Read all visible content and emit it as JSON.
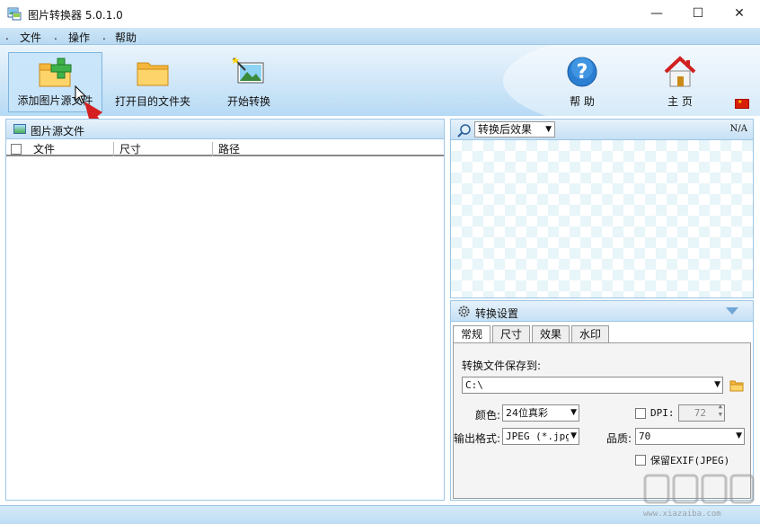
{
  "window": {
    "title": "图片转换器 5.0.1.0",
    "controls": {
      "minimize": "—",
      "maximize": "☐",
      "close": "✕"
    }
  },
  "menu": {
    "items": [
      "文件",
      "操作",
      "帮助"
    ]
  },
  "toolbar": {
    "add_source": "添加图片源文件",
    "open_target_folder": "打开目的文件夹",
    "start_convert": "开始转换",
    "help": "帮 助",
    "home": "主 页"
  },
  "left_panel": {
    "title": "图片源文件",
    "columns": [
      "文件",
      "尺寸",
      "路径"
    ]
  },
  "preview": {
    "effect_select": "转换后效果",
    "na": "N/A"
  },
  "settings": {
    "title": "转换设置",
    "tabs": [
      "常规",
      "尺寸",
      "效果",
      "水印"
    ],
    "save_to_label": "转换文件保存到:",
    "save_path": "C:\\",
    "color_label": "颜色:",
    "color_value": "24位真彩",
    "dpi_label": "DPI:",
    "dpi_value": "72",
    "format_label": "输出格式:",
    "format_value": "JPEG (*.jpg",
    "quality_label": "品质:",
    "quality_value": "70",
    "exif_label": "保留EXIF(JPEG)"
  },
  "watermark": {
    "text": "www.xiazaiba.com"
  },
  "colors": {
    "accent": "#9cc6e6",
    "toolbar_bg": "#cfe6f8",
    "arrow": "#d42020"
  }
}
